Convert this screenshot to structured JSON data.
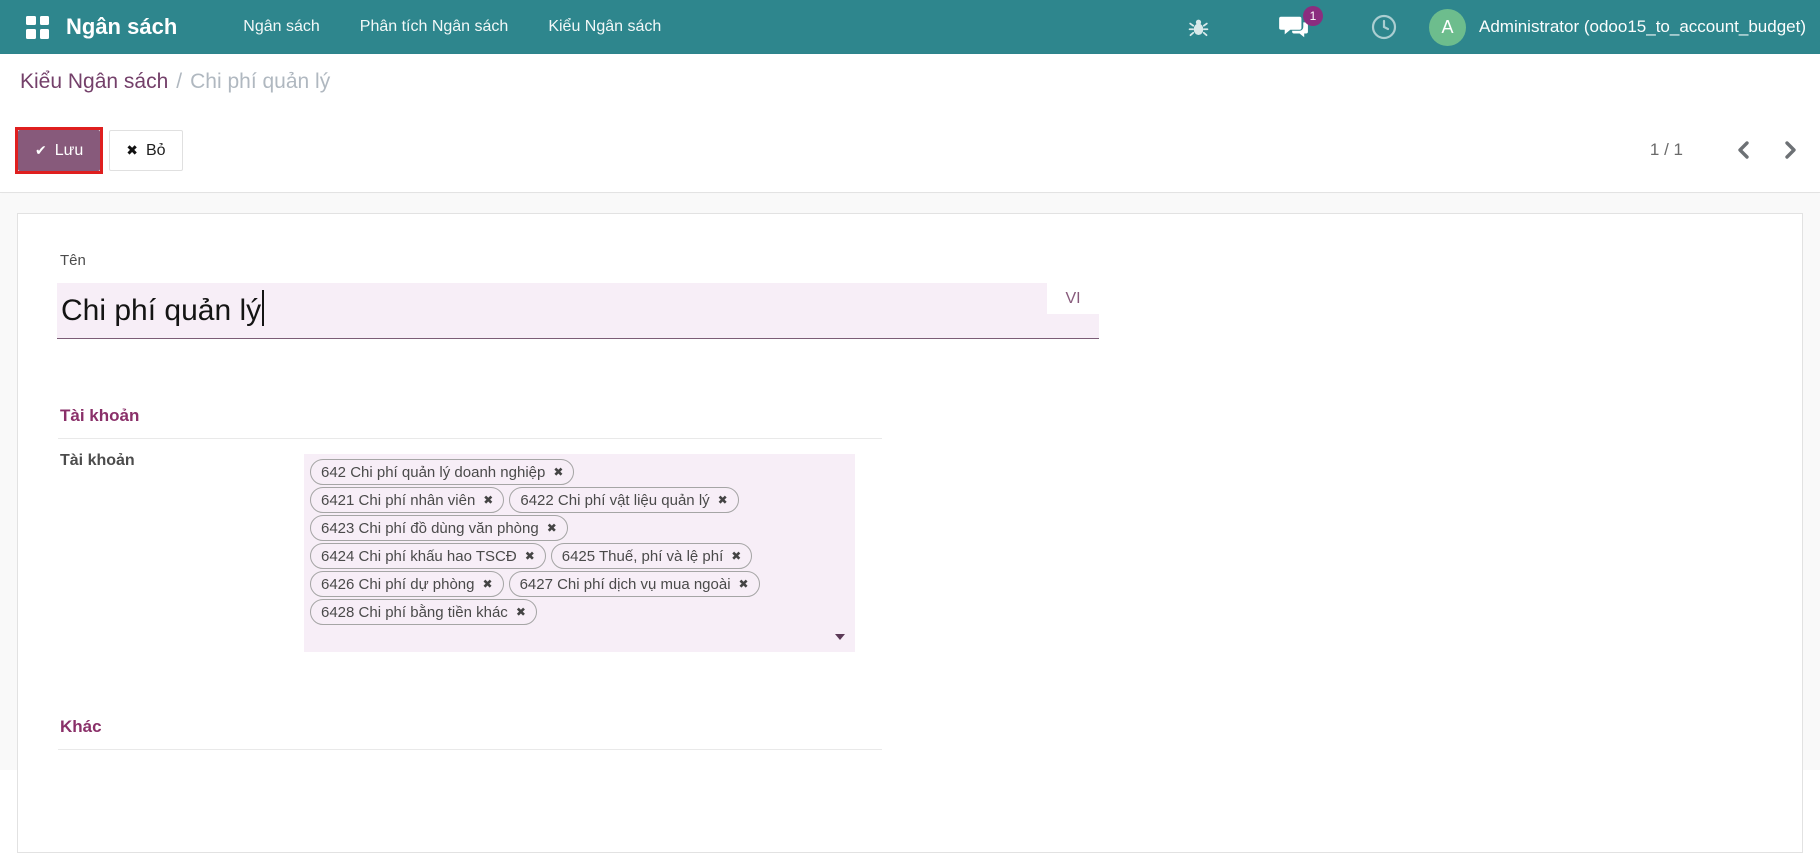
{
  "navbar": {
    "brand": "Ngân sách",
    "menus": [
      {
        "label": "Ngân sách"
      },
      {
        "label": "Phân tích Ngân sách"
      },
      {
        "label": "Kiểu Ngân sách"
      }
    ],
    "systray": {
      "message_badge": "1",
      "avatar_letter": "A",
      "user": "Administrator (odoo15_to_account_budget)"
    }
  },
  "breadcrumb": {
    "parent": "Kiểu Ngân sách",
    "separator": "/",
    "current": "Chi phí quản lý"
  },
  "control_panel": {
    "save_label": "Lưu",
    "discard_label": "Bỏ",
    "pager_count": "1 / 1"
  },
  "form": {
    "name_label": "Tên",
    "name_value": "Chi phí quản lý",
    "lang_badge": "VI",
    "accounts_section_title": "Tài khoản",
    "accounts_field_label": "Tài khoản",
    "other_section_title": "Khác",
    "account_tag_rows": [
      [
        "642 Chi phí quản lý doanh nghiệp"
      ],
      [
        "6421 Chi phí nhân viên",
        "6422 Chi phí vật liệu quản lý"
      ],
      [
        "6423 Chi phí đồ dùng văn phòng"
      ],
      [
        "6424 Chi phí khấu hao TSCĐ",
        "6425 Thuế, phí và lệ phí"
      ],
      [
        "6426 Chi phí dự phòng",
        "6427 Chi phí dịch vụ mua ngoài"
      ],
      [
        "6428 Chi phí bằng tiền khác"
      ]
    ]
  },
  "icons": {
    "check": "✔",
    "close": "✖",
    "delete_tag": "✖"
  },
  "colors": {
    "navbar": "#2e868d",
    "primary": "#875A7B",
    "section_heading": "#8a3069",
    "annotation_red": "#df1f1f",
    "field_background": "#f7eef7",
    "badge_purple": "#8b2d7f",
    "avatar_green": "#6dbd8d"
  }
}
